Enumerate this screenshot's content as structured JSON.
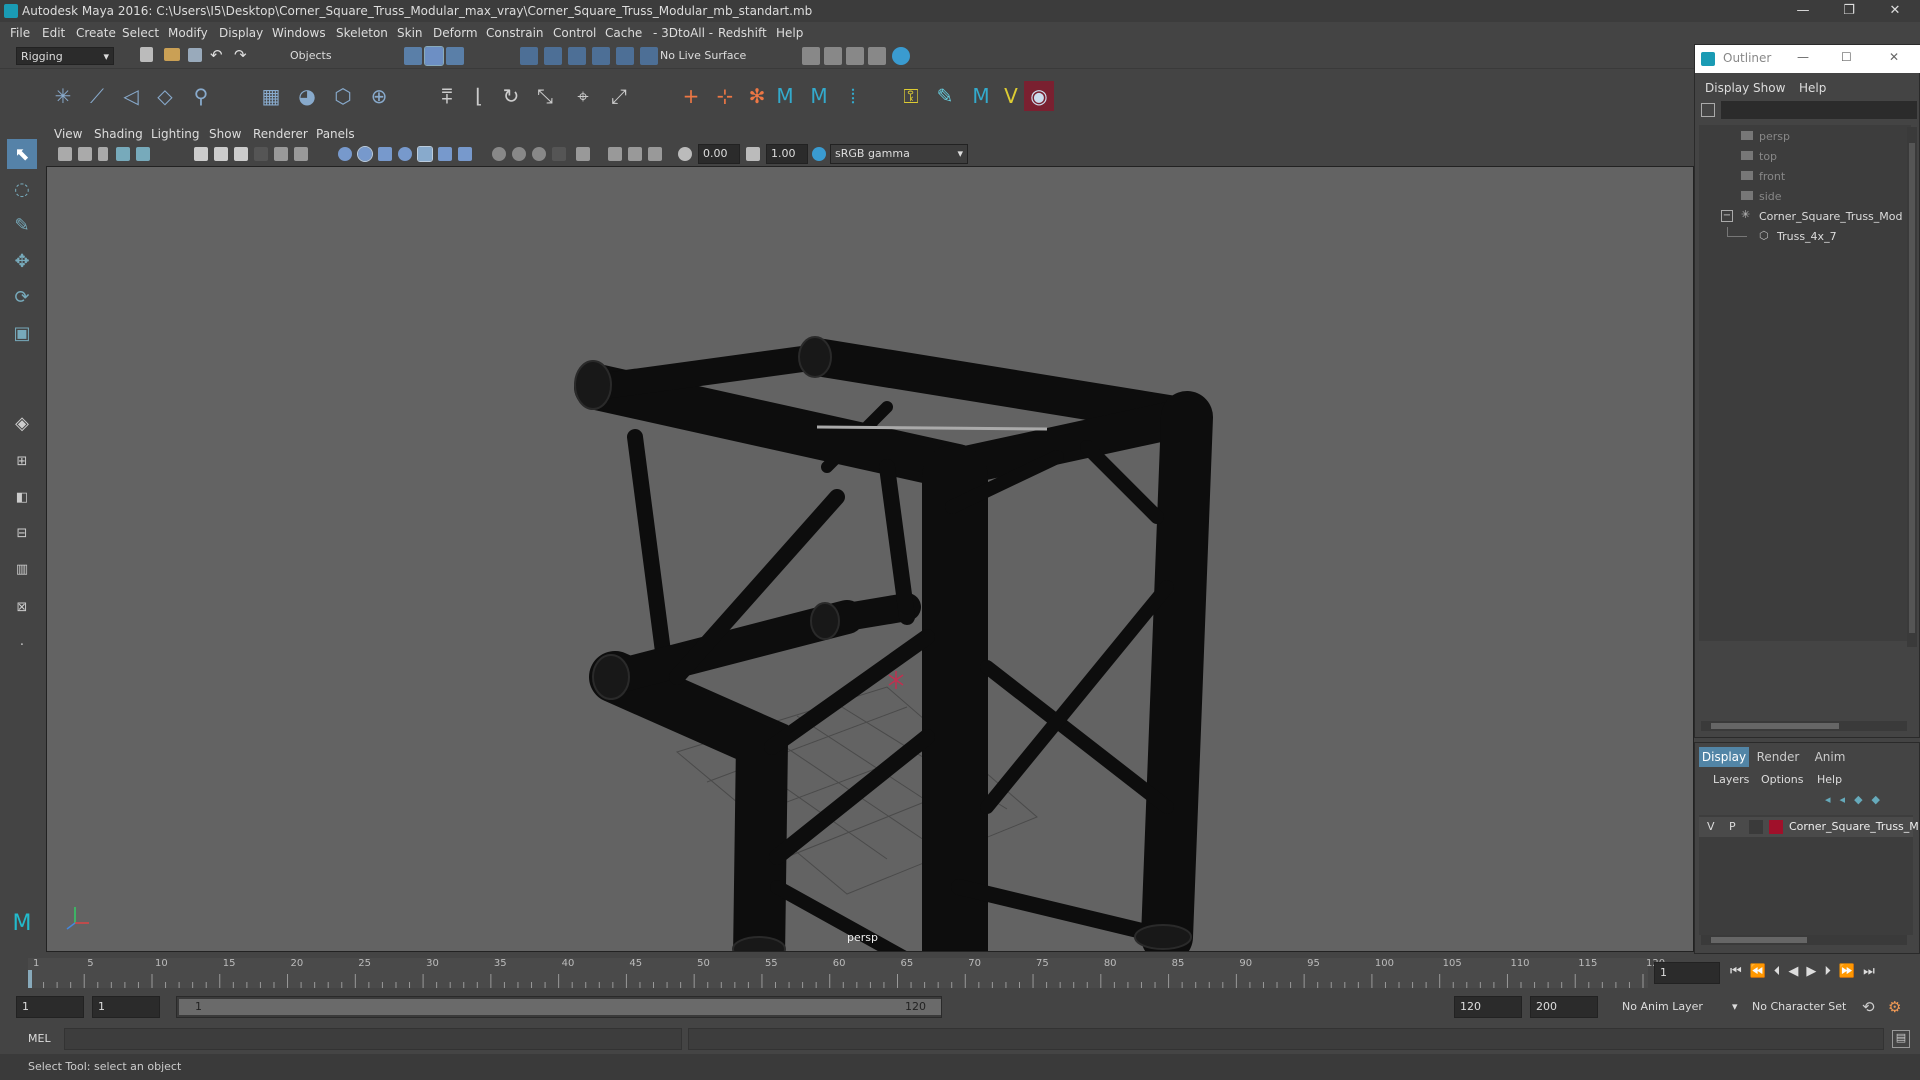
{
  "titlebar": {
    "title": "Autodesk Maya 2016: C:\\Users\\I5\\Desktop\\Corner_Square_Truss_Modular_max_vray\\Corner_Square_Truss_Modular_mb_standart.mb",
    "minimize": "—",
    "maximize": "❐",
    "close": "✕"
  },
  "menubar": [
    "File",
    "Edit",
    "Create",
    "Select",
    "Modify",
    "Display",
    "Windows",
    "Skeleton",
    "Skin",
    "Deform",
    "Constrain",
    "Control",
    "Cache",
    "- 3DtoAll -",
    "Redshift",
    "Help"
  ],
  "statusline": {
    "menuset": "Rigging",
    "selmode": "Objects",
    "live_surface": "No Live Surface"
  },
  "viewport": {
    "menus": [
      "View",
      "Shading",
      "Lighting",
      "Show",
      "Renderer",
      "Panels"
    ],
    "exposure": "0.00",
    "gamma": "1.00",
    "colorspace": "sRGB gamma",
    "camera_label": "persp"
  },
  "outliner": {
    "title": "Outliner",
    "menus": [
      "Display",
      "Show",
      "Help"
    ],
    "items": [
      {
        "label": "persp",
        "icon": "camera-icon"
      },
      {
        "label": "top",
        "icon": "camera-icon"
      },
      {
        "label": "front",
        "icon": "camera-icon"
      },
      {
        "label": "side",
        "icon": "camera-icon"
      },
      {
        "label": "Corner_Square_Truss_Mod",
        "icon": "group-icon"
      },
      {
        "label": "Truss_4x_7",
        "icon": "mesh-icon"
      }
    ],
    "collapse": "−"
  },
  "layers": {
    "tabs": [
      "Display",
      "Render",
      "Anim"
    ],
    "menus": [
      "Layers",
      "Options",
      "Help"
    ],
    "row": {
      "v": "V",
      "p": "P",
      "name": "Corner_Square_Truss_M",
      "color": "#a0102a"
    }
  },
  "timeslider": {
    "ticks": [
      "1",
      "5",
      "10",
      "15",
      "20",
      "25",
      "30",
      "35",
      "40",
      "45",
      "50",
      "55",
      "60",
      "65",
      "70",
      "75",
      "80",
      "85",
      "90",
      "95",
      "100",
      "105",
      "110",
      "115",
      "120"
    ],
    "current_frame": "1"
  },
  "rangeslider": {
    "start": "1",
    "range_start": "1",
    "range_bar_start": "1",
    "range_bar_end": "120",
    "end": "120",
    "anim_end": "200",
    "anim_layer": "No Anim Layer",
    "char_set": "No Character Set"
  },
  "cmdline": {
    "label": "MEL"
  },
  "helpline": {
    "text": "Select Tool: select an object"
  }
}
